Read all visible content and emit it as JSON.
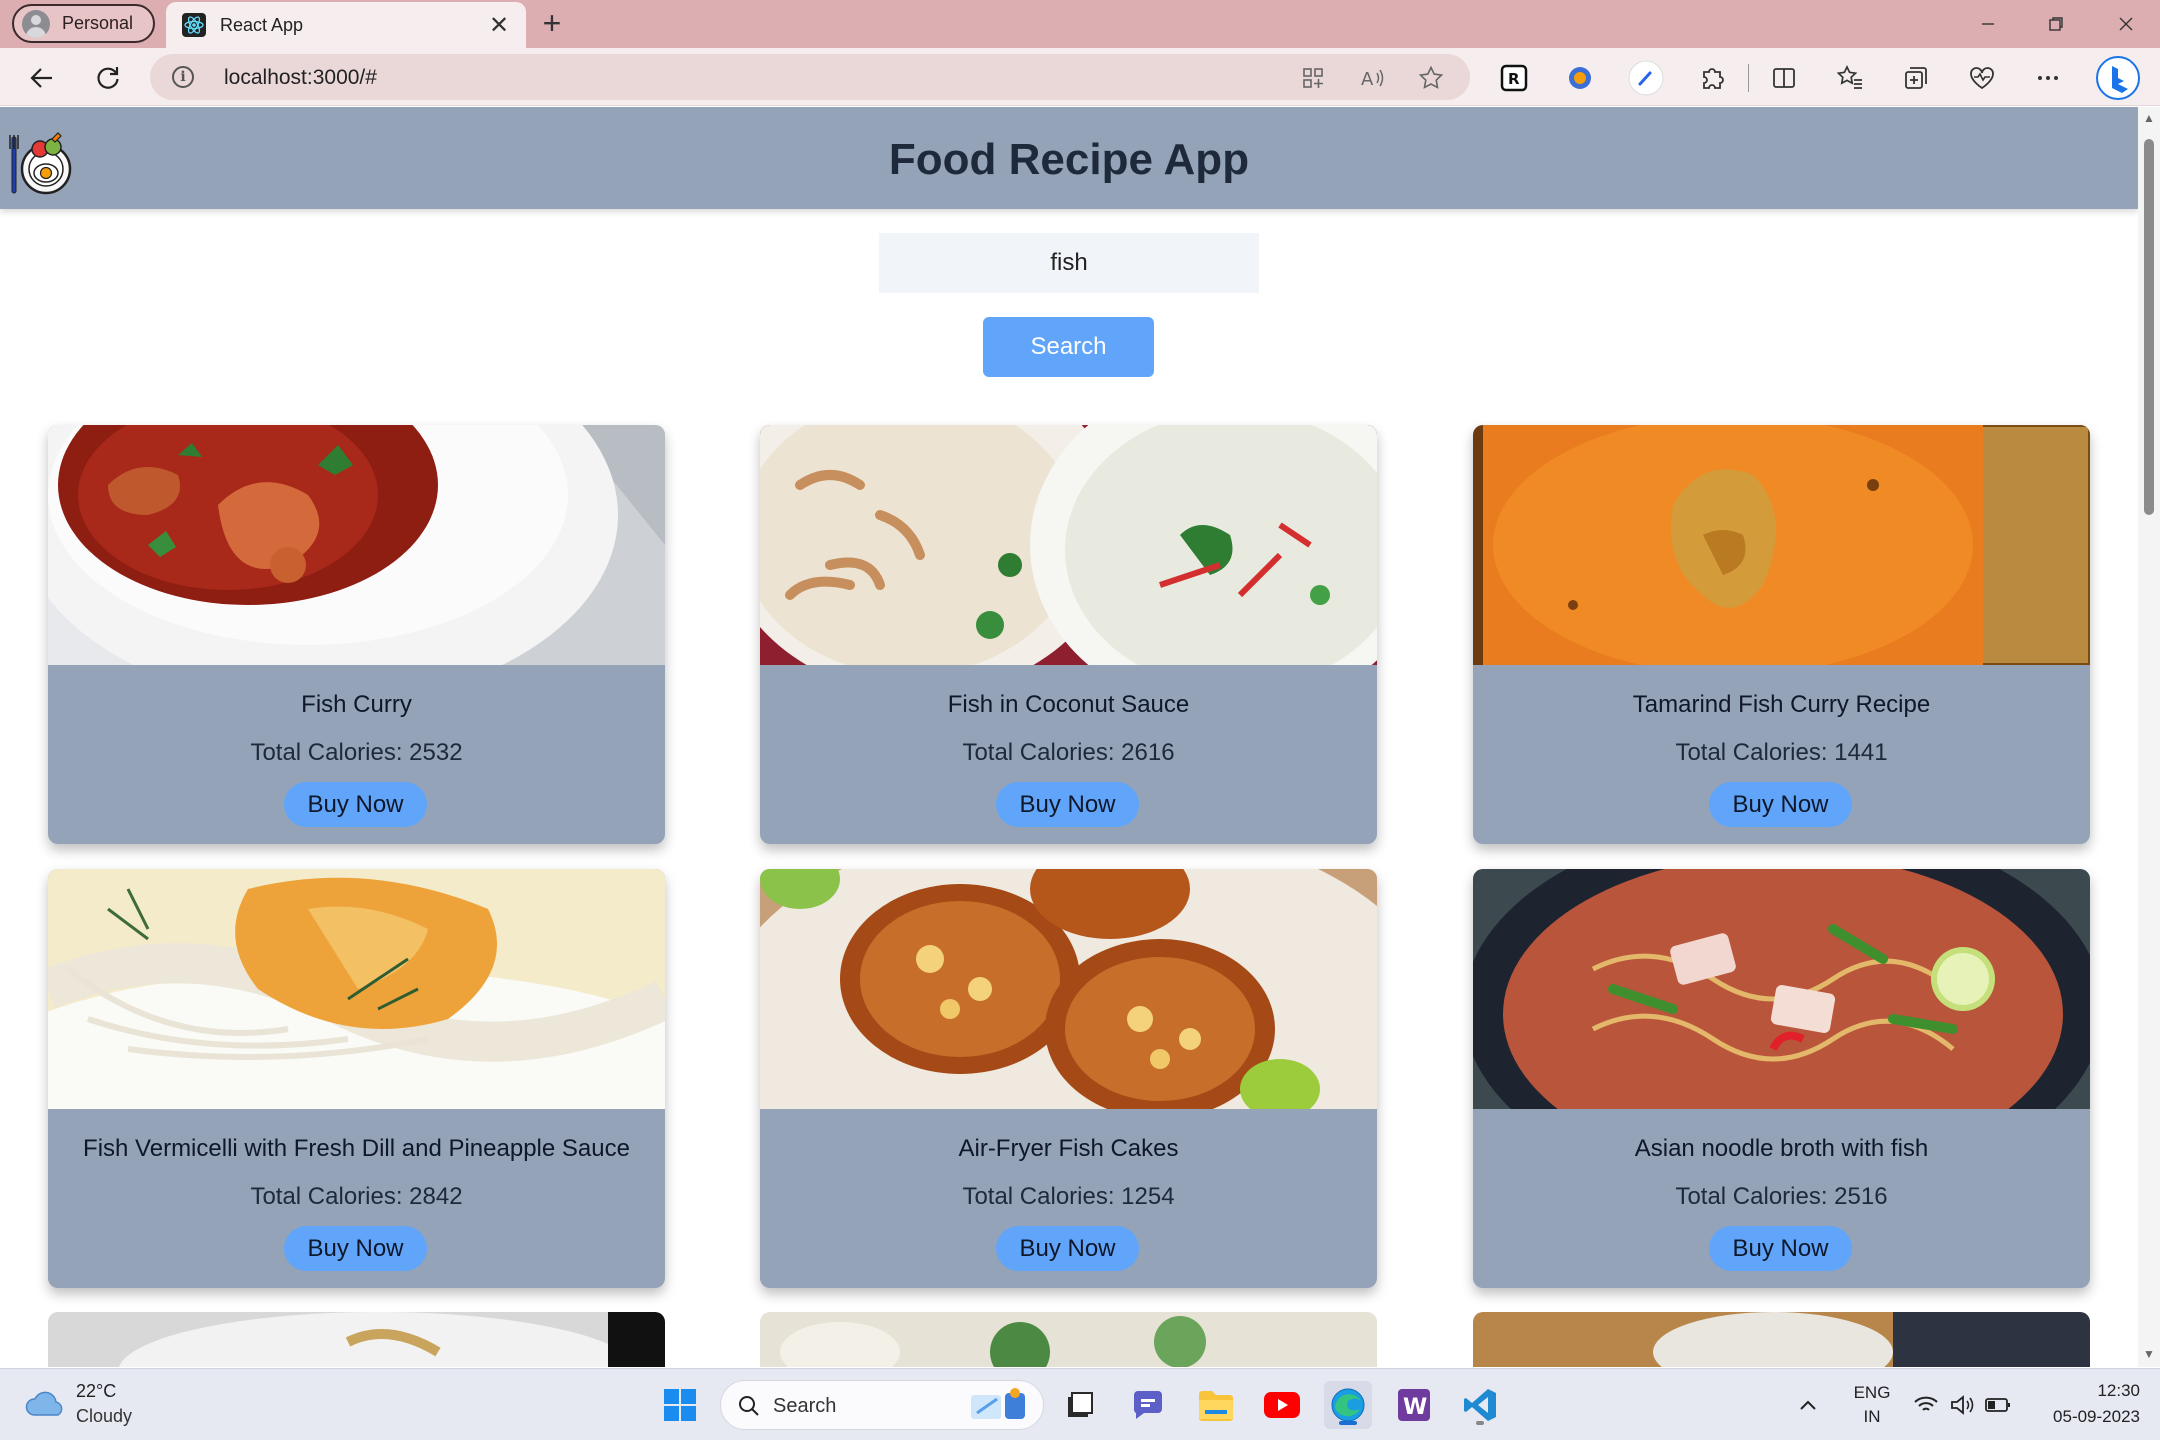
{
  "browser": {
    "profile_label": "Personal",
    "tab_title": "React App",
    "url": "localhost:3000/#"
  },
  "app": {
    "title": "Food Recipe App"
  },
  "search": {
    "value": "fish",
    "button_label": "Search"
  },
  "recipes": [
    {
      "title": "Fish Curry",
      "calories": "Total Calories: 2532",
      "button": "Buy Now"
    },
    {
      "title": "Fish in Coconut Sauce",
      "calories": "Total Calories: 2616",
      "button": "Buy Now"
    },
    {
      "title": "Tamarind Fish Curry Recipe",
      "calories": "Total Calories: 1441",
      "button": "Buy Now"
    },
    {
      "title": "Fish Vermicelli with Fresh Dill and Pineapple Sauce",
      "calories": "Total Calories: 2842",
      "button": "Buy Now"
    },
    {
      "title": "Air-Fryer Fish Cakes",
      "calories": "Total Calories: 1254",
      "button": "Buy Now"
    },
    {
      "title": "Asian noodle broth with fish",
      "calories": "Total Calories: 2516",
      "button": "Buy Now"
    }
  ],
  "taskbar": {
    "weather_temp": "22°C",
    "weather_cond": "Cloudy",
    "search_label": "Search",
    "lang_1": "ENG",
    "lang_2": "IN",
    "time": "12:30",
    "date": "05-09-2023"
  },
  "colors": {
    "header_bg": "#94a3b8",
    "accent_blue": "#60a5fa",
    "tab_strip": "#dcaeb1",
    "card_bg": "#94a3b8"
  }
}
